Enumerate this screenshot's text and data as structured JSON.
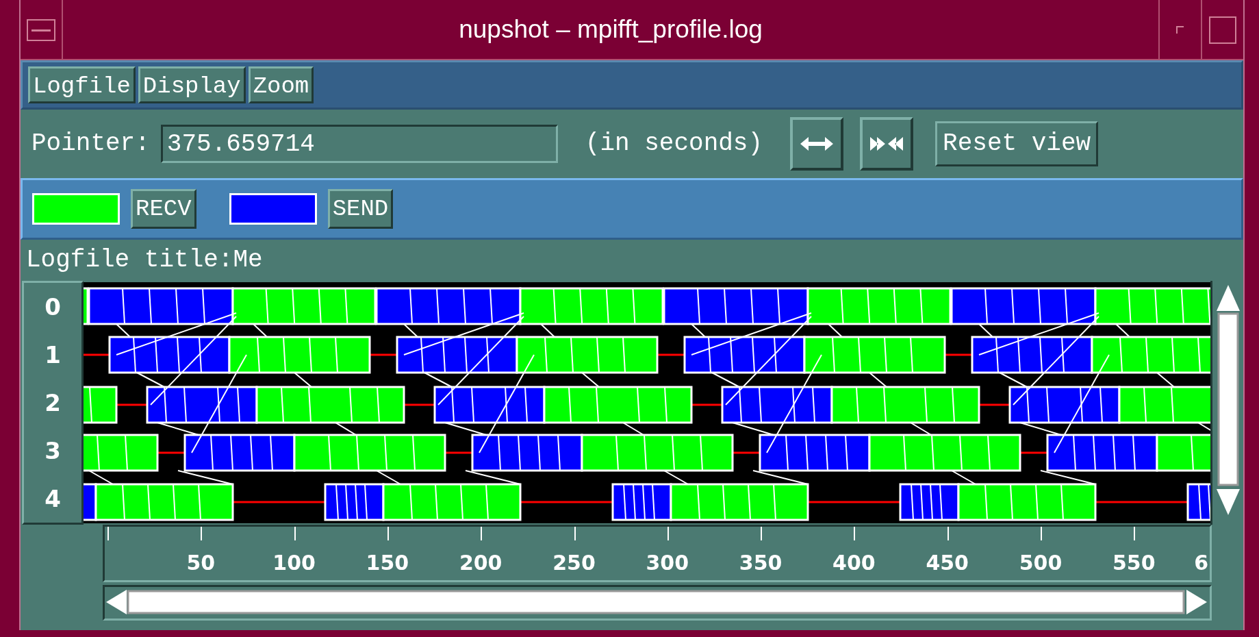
{
  "window": {
    "title": "nupshot – mpifft_profile.log"
  },
  "menu": [
    "Logfile",
    "Display",
    "Zoom"
  ],
  "pointer": {
    "label": "Pointer:",
    "value": "375.659714",
    "unit": "(in seconds)"
  },
  "toolbar": {
    "reset_button": "Reset view"
  },
  "legend": [
    {
      "label": "RECV",
      "color": "#00ff00"
    },
    {
      "label": "SEND",
      "color": "#0000ff"
    }
  ],
  "logfile_title": "Logfile title:Me",
  "timeline": {
    "rows": [
      "0",
      "1",
      "2",
      "3",
      "4"
    ]
  },
  "axis": {
    "tick_labels": [
      "50",
      "100",
      "150",
      "200",
      "250",
      "300",
      "350",
      "400",
      "450",
      "500",
      "550",
      "6"
    ]
  }
}
